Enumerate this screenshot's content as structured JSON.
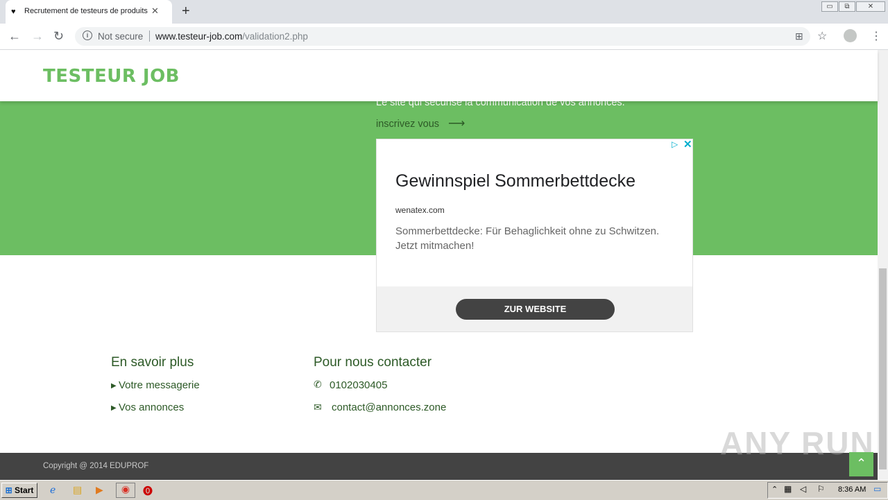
{
  "browser": {
    "tab_title": "Recrutement de testeurs de produits",
    "tab_favicon": "♥",
    "tab_close": "✕",
    "new_tab": "+",
    "security_label": "Not secure",
    "url_host": "www.testeur-job.com",
    "url_path": "/validation2.php",
    "window_controls": [
      "▭",
      "⧉",
      "✕"
    ],
    "nav_icons": [
      "arrow-left-icon",
      "arrow-right-icon",
      "reload-icon"
    ]
  },
  "site": {
    "brand": "TESTEUR JOB",
    "hero_subtitle": "Le site qui sécurise la communication de vos annonces.",
    "hero_link": "inscrivez vous",
    "brand_color": "#6cbe62"
  },
  "ad": {
    "title": "Gewinnspiel Sommerbettdecke",
    "domain": "wenatex.com",
    "description": "Sommerbettdecke: Für Behaglichkeit ohne zu Schwitzen. Jetzt mitmachen!",
    "cta": "ZUR WEBSITE",
    "choices_icon": "▷",
    "close_icon": "✕"
  },
  "footer": {
    "col1_title": "En savoir plus",
    "col1_links": [
      "Votre messagerie",
      "Vos annonces"
    ],
    "col2_title": "Pour nous contacter",
    "phone": "0102030405",
    "email": "contact@annonces.zone",
    "copyright": "Copyright @ 2014 EDUPROF"
  },
  "watermark": "ANY RUN",
  "taskbar": {
    "start_label": "Start",
    "clock": "8:36 AM"
  }
}
